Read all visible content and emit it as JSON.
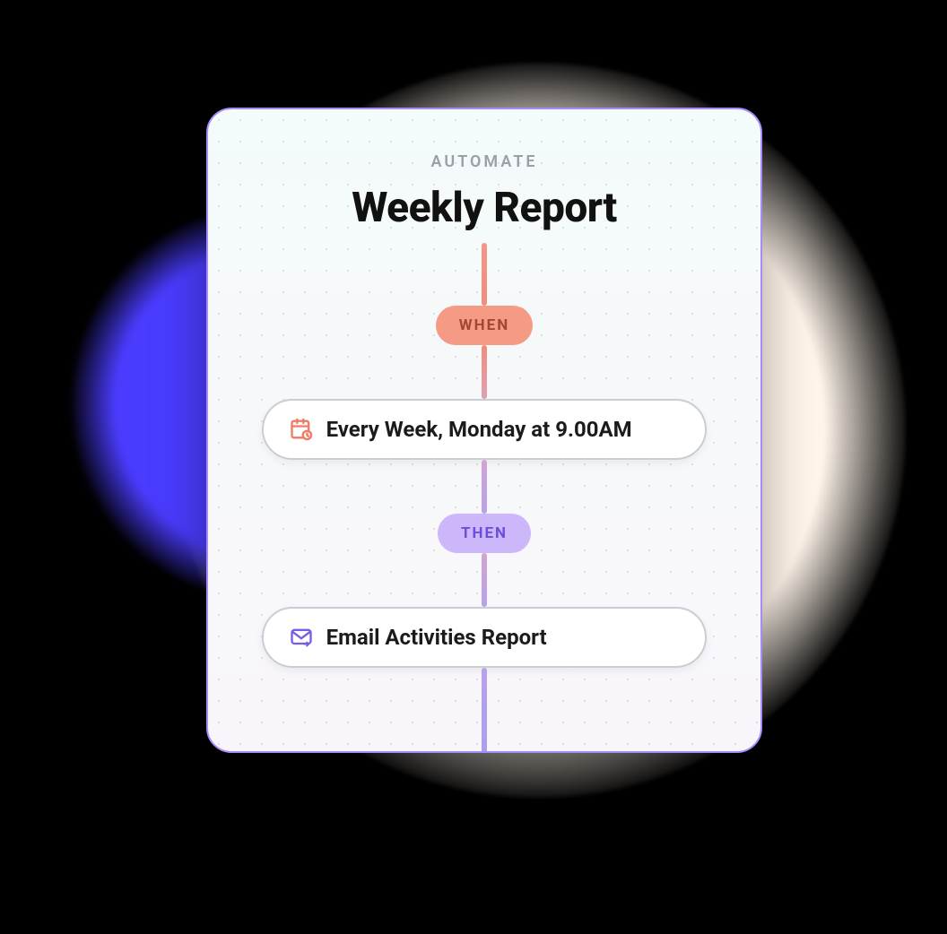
{
  "section_label": "AUTOMATE",
  "title": "Weekly Report",
  "when": {
    "badge": "WHEN",
    "icon": "calendar-clock-icon",
    "text": "Every Week, Monday at 9.00AM"
  },
  "then": {
    "badge": "THEN",
    "icon": "mail-forward-icon",
    "text": "Email Activities Report"
  },
  "colors": {
    "card_border": "#a78bfa",
    "when_badge_bg": "#f59a84",
    "then_badge_bg": "#cdb7fb",
    "blue_blob": "#4a3cff",
    "cream_blob": "#fff5ea"
  }
}
